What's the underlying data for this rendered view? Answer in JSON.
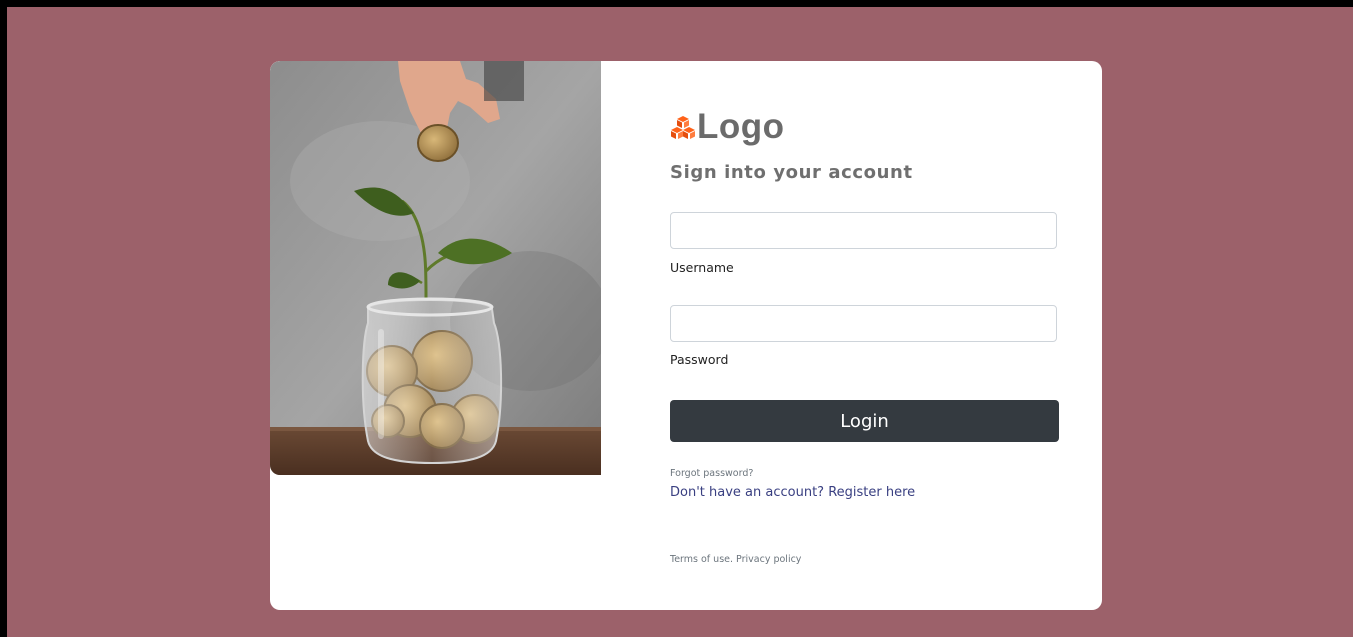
{
  "colors": {
    "page_background": "#9c616a",
    "card_background": "#ffffff",
    "logo_accent": "#ff6219",
    "button_background": "#343a40",
    "link_color": "#393f81"
  },
  "hero_image": {
    "icon": "coins-jar-plant-photo"
  },
  "brand": {
    "logo_icon": "cubes-icon",
    "logo_text": "Logo"
  },
  "form": {
    "heading": "Sign into your account",
    "username": {
      "value": "",
      "placeholder": "",
      "label": "Username"
    },
    "password": {
      "value": "",
      "placeholder": "",
      "label": "Password"
    },
    "login_label": "Login",
    "forgot_label": "Forgot password?",
    "register_label": "Don't have an account? Register here"
  },
  "footer": {
    "terms_label": "Terms of use.",
    "privacy_label": "Privacy policy"
  }
}
